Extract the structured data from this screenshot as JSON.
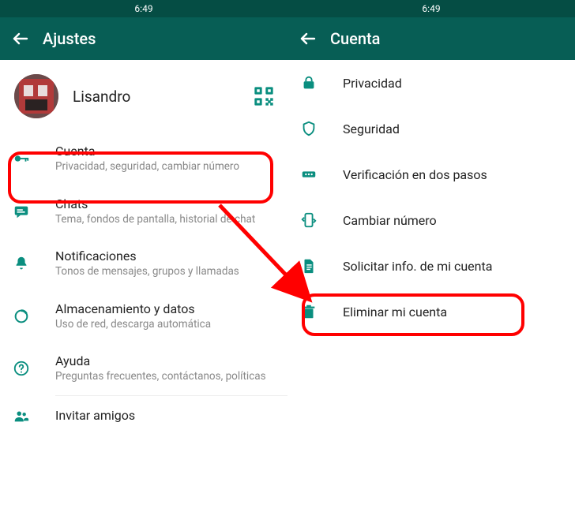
{
  "statusTime": "6:49",
  "colors": {
    "brand": "#075e55",
    "brandDark": "#054d44",
    "accent": "#0a8e7f",
    "highlight": "#ff0000"
  },
  "left": {
    "title": "Ajustes",
    "profileName": "Lisandro",
    "items": [
      {
        "label": "Cuenta",
        "sub": "Privacidad, seguridad, cambiar número"
      },
      {
        "label": "Chats",
        "sub": "Tema, fondos de pantalla, historial de chat"
      },
      {
        "label": "Notificaciones",
        "sub": "Tonos de mensajes, grupos y llamadas"
      },
      {
        "label": "Almacenamiento y datos",
        "sub": "Uso de red, descarga automática"
      },
      {
        "label": "Ayuda",
        "sub": "Preguntas frecuentes, contáctanos, políticas"
      },
      {
        "label": "Invitar amigos"
      }
    ]
  },
  "right": {
    "title": "Cuenta",
    "items": [
      {
        "label": "Privacidad"
      },
      {
        "label": "Seguridad"
      },
      {
        "label": "Verificación en dos pasos"
      },
      {
        "label": "Cambiar número"
      },
      {
        "label": "Solicitar info. de mi cuenta"
      },
      {
        "label": "Eliminar mi cuenta"
      }
    ]
  }
}
